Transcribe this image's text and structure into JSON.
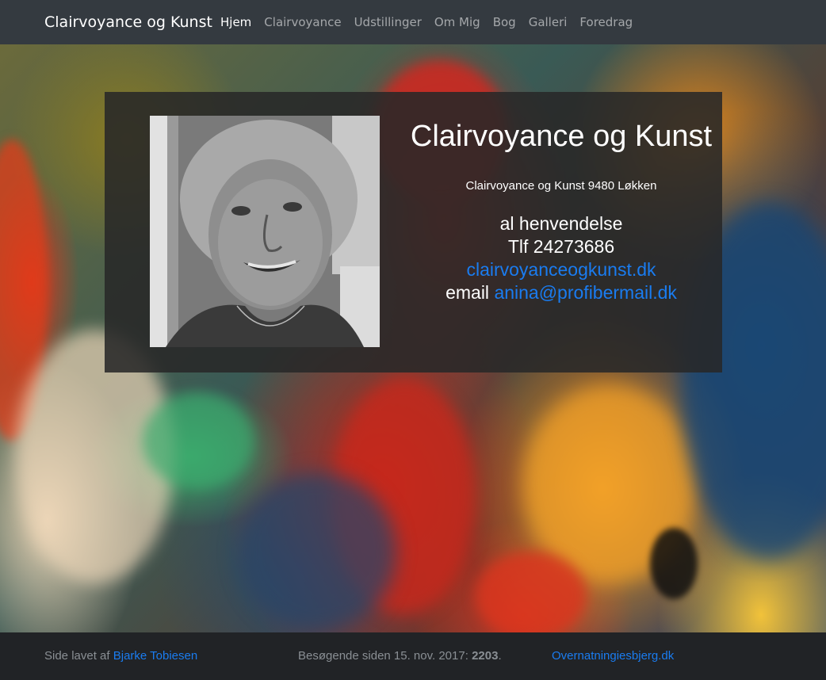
{
  "navbar": {
    "brand": "Clairvoyance og Kunst",
    "items": [
      {
        "label": "Hjem",
        "active": true
      },
      {
        "label": "Clairvoyance",
        "active": false
      },
      {
        "label": "Udstillinger",
        "active": false
      },
      {
        "label": "Om Mig",
        "active": false
      },
      {
        "label": "Bog",
        "active": false
      },
      {
        "label": "Galleri",
        "active": false
      },
      {
        "label": "Foredrag",
        "active": false
      }
    ]
  },
  "hero": {
    "title": "Clairvoyance og Kunst",
    "address": "Clairvoyance og Kunst 9480 Løkken",
    "contact_line1": "al henvendelse",
    "phone_text": "Tlf 24273686",
    "website_link": "clairvoyanceogkunst.dk",
    "email_prefix": "email",
    "email_link": "anina@profibermail.dk"
  },
  "footer": {
    "made_by_prefix": "Side lavet af",
    "made_by_link": "Bjarke Tobiesen",
    "visitors_prefix": "Besøgende siden 15. nov. 2017:",
    "visitors_count": "2203",
    "visitors_suffix": ".",
    "partner_link": "Overnatningiesbjerg.dk"
  },
  "colors": {
    "navbar_bg": "#343a40",
    "link": "#1a7cf0",
    "footer_bg": "#212326"
  }
}
